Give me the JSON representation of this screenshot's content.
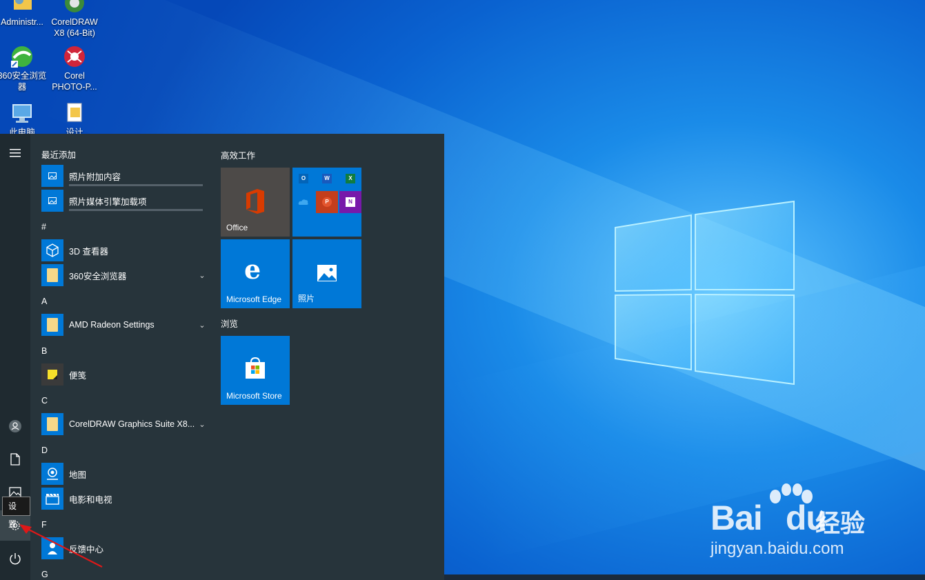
{
  "desktop": {
    "icons": [
      {
        "label": "Administr...",
        "icon": "user-folder-icon"
      },
      {
        "label": "CorelDRAW X8 (64-Bit)",
        "icon": "coreldraw-icon"
      },
      {
        "label": "360安全浏览器",
        "icon": "browser-360-icon"
      },
      {
        "label": "Corel PHOTO-P...",
        "icon": "corel-photo-paint-icon"
      },
      {
        "label": "此电脑",
        "icon": "this-pc-icon"
      },
      {
        "label": "设计",
        "icon": "folder-shortcut-icon"
      }
    ],
    "watermark": {
      "brand": "Bai",
      "brand2": "du",
      "cn": "经验",
      "url": "jingyan.baidu.com"
    }
  },
  "start_menu": {
    "rail": {
      "tooltip": "设置",
      "buttons": [
        "hamburger-icon",
        "user-icon",
        "documents-icon",
        "pictures-icon",
        "settings-icon",
        "power-icon"
      ]
    },
    "recent_header": "最近添加",
    "recent": [
      {
        "label": "照片附加内容"
      },
      {
        "label": "照片媒体引擎加载项"
      }
    ],
    "sections": [
      {
        "letter": "#",
        "apps": [
          {
            "label": "3D 查看器",
            "expandable": false
          },
          {
            "label": "360安全浏览器",
            "expandable": true
          }
        ]
      },
      {
        "letter": "A",
        "apps": [
          {
            "label": "AMD Radeon Settings",
            "expandable": true
          }
        ]
      },
      {
        "letter": "B",
        "apps": [
          {
            "label": "便笺",
            "expandable": false
          }
        ]
      },
      {
        "letter": "C",
        "apps": [
          {
            "label": "CorelDRAW Graphics Suite X8...",
            "expandable": true
          }
        ]
      },
      {
        "letter": "D",
        "apps": [
          {
            "label": "地图",
            "expandable": false
          },
          {
            "label": "电影和电视",
            "expandable": false
          }
        ]
      },
      {
        "letter": "F",
        "apps": [
          {
            "label": "反馈中心",
            "expandable": false
          }
        ]
      },
      {
        "letter": "G",
        "apps": []
      }
    ],
    "tile_groups": [
      {
        "title": "高效工作",
        "tiles": [
          {
            "label": "Office",
            "color": "#4d4a48"
          },
          {
            "label": "",
            "color": "#0078d7"
          },
          {
            "label": "Microsoft Edge",
            "color": "#0078d7"
          },
          {
            "label": "照片",
            "color": "#0078d7"
          }
        ]
      },
      {
        "title": "浏览",
        "tiles": [
          {
            "label": "Microsoft Store",
            "color": "#0078d7"
          }
        ]
      }
    ],
    "office_mini_apps": [
      {
        "letter": "O",
        "color": "#0364b8",
        "icon": "outlook-icon"
      },
      {
        "letter": "W",
        "color": "#185abd",
        "icon": "word-icon"
      },
      {
        "letter": "X",
        "color": "#107c41",
        "icon": "excel-icon"
      },
      {
        "letter": "",
        "color": "#0078d4",
        "icon": "onedrive-icon"
      },
      {
        "letter": "P",
        "color": "#c43e1c",
        "icon": "powerpoint-icon"
      },
      {
        "letter": "N",
        "color": "#7719aa",
        "icon": "onenote-icon"
      }
    ]
  }
}
